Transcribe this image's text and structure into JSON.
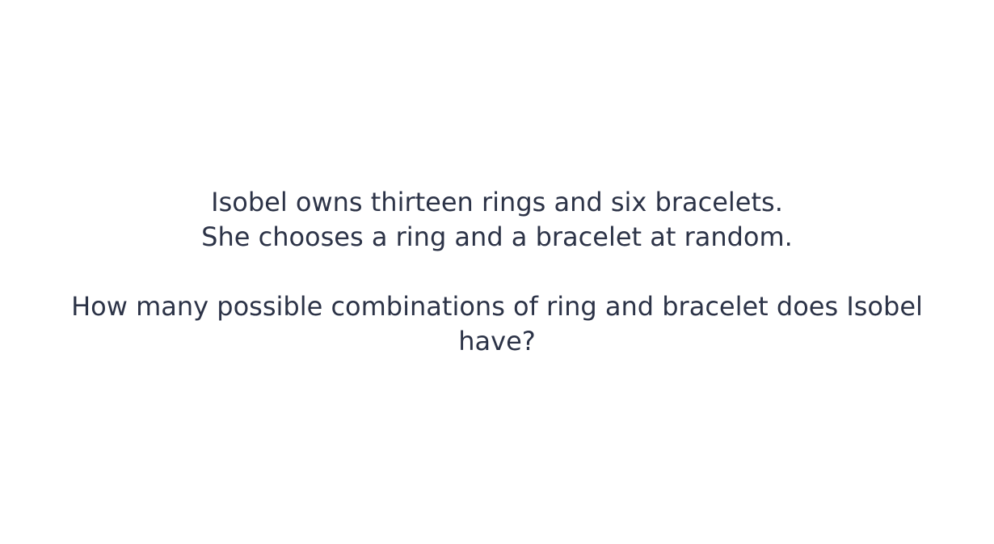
{
  "question": {
    "intro_line_1": "Isobel owns thirteen rings and six bracelets.",
    "intro_line_2": "She chooses a ring and a bracelet at random.",
    "prompt": "How many possible combinations of ring and bracelet does Isobel have?"
  },
  "colors": {
    "background": "#ffffff",
    "text": "#2c3347"
  }
}
